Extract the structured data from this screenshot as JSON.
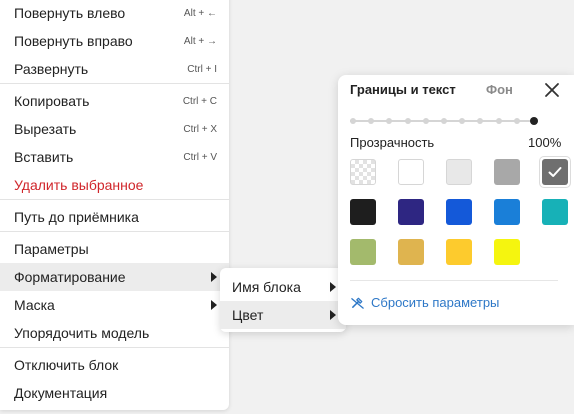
{
  "context_menu": {
    "items": [
      {
        "label": "Повернуть влево",
        "shortcut": "Alt + ←"
      },
      {
        "label": "Повернуть вправо",
        "shortcut": "Alt + →"
      },
      {
        "label": "Развернуть",
        "shortcut": "Ctrl + I"
      },
      {
        "label": "Копировать",
        "shortcut": "Ctrl + C"
      },
      {
        "label": "Вырезать",
        "shortcut": "Ctrl + X"
      },
      {
        "label": "Вставить",
        "shortcut": "Ctrl + V"
      },
      {
        "label": "Удалить выбранное"
      },
      {
        "label": "Путь до приёмника"
      },
      {
        "label": "Параметры"
      },
      {
        "label": "Форматирование"
      },
      {
        "label": "Маска"
      },
      {
        "label": "Упорядочить модель"
      },
      {
        "label": "Отключить блок"
      },
      {
        "label": "Документация"
      }
    ]
  },
  "submenu": {
    "items": [
      {
        "label": "Имя блока"
      },
      {
        "label": "Цвет"
      }
    ]
  },
  "color_panel": {
    "tabs": [
      "Границы и текст",
      "Фон"
    ],
    "opacity_label": "Прозрачность",
    "opacity_value": "100%",
    "opacity_fraction": 1.0,
    "swatches": [
      {
        "name": "transparent",
        "color": "transparent"
      },
      {
        "name": "white",
        "color": "#ffffff"
      },
      {
        "name": "light-gray",
        "color": "#e8e8e8"
      },
      {
        "name": "gray",
        "color": "#a8a8a8"
      },
      {
        "name": "dark-gray",
        "color": "#6f6f6f",
        "selected": true
      },
      {
        "name": "black",
        "color": "#1e1e1e"
      },
      {
        "name": "indigo",
        "color": "#2e2682"
      },
      {
        "name": "blue",
        "color": "#1459d9"
      },
      {
        "name": "sky-blue",
        "color": "#1a7fd8"
      },
      {
        "name": "teal",
        "color": "#17b1b7"
      },
      {
        "name": "olive-green",
        "color": "#a3ba6c"
      },
      {
        "name": "mustard",
        "color": "#dfb44f"
      },
      {
        "name": "yellow",
        "color": "#fdcb2d"
      },
      {
        "name": "lemon",
        "color": "#f5f50f"
      }
    ],
    "reset_label": "Сбросить параметры"
  },
  "colors": {
    "danger": "#d0262b",
    "link": "#2e78c7",
    "highlight": "#ececec"
  }
}
